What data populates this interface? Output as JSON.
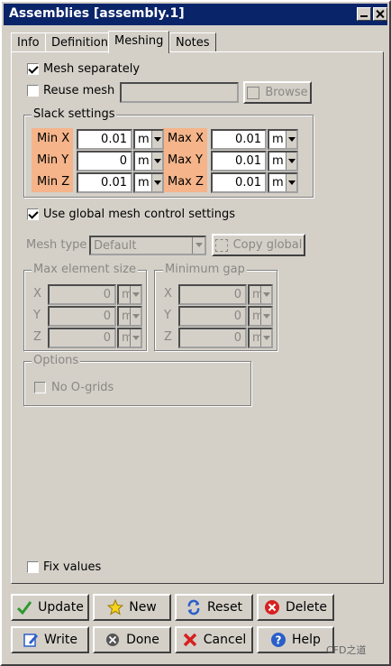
{
  "window": {
    "title": "Assemblies [assembly.1]"
  },
  "tabs": [
    {
      "label": "Info"
    },
    {
      "label": "Definition"
    },
    {
      "label": "Meshing"
    },
    {
      "label": "Notes"
    }
  ],
  "meshing": {
    "mesh_separately": {
      "label": "Mesh separately",
      "checked": true
    },
    "reuse_mesh": {
      "label": "Reuse mesh",
      "checked": false,
      "value": ""
    },
    "browse_label": "Browse",
    "slack": {
      "title": "Slack settings",
      "min_x": {
        "label": "Min X",
        "value": "0.01",
        "unit": "m"
      },
      "min_y": {
        "label": "Min Y",
        "value": "0",
        "unit": "m"
      },
      "min_z": {
        "label": "Min Z",
        "value": "0.01",
        "unit": "m"
      },
      "max_x": {
        "label": "Max X",
        "value": "0.01",
        "unit": "m"
      },
      "max_y": {
        "label": "Max Y",
        "value": "0.01",
        "unit": "m"
      },
      "max_z": {
        "label": "Max Z",
        "value": "0.01",
        "unit": "m"
      }
    },
    "use_global": {
      "label": "Use global mesh control settings",
      "checked": true
    },
    "mesh_type": {
      "label": "Mesh type",
      "value": "Default"
    },
    "copy_global_label": "Copy global",
    "max_element_size": {
      "title": "Max element size",
      "x": {
        "label": "X",
        "value": "0",
        "unit": "m"
      },
      "y": {
        "label": "Y",
        "value": "0",
        "unit": "m"
      },
      "z": {
        "label": "Z",
        "value": "0",
        "unit": "m"
      }
    },
    "minimum_gap": {
      "title": "Minimum gap",
      "x": {
        "label": "X",
        "value": "0",
        "unit": "m"
      },
      "y": {
        "label": "Y",
        "value": "0",
        "unit": "m"
      },
      "z": {
        "label": "Z",
        "value": "0",
        "unit": "m"
      }
    },
    "options": {
      "title": "Options",
      "no_ogrids": {
        "label": "No O-grids",
        "checked": false
      }
    },
    "fix_values": {
      "label": "Fix values",
      "checked": false
    }
  },
  "buttons": {
    "update": "Update",
    "new": "New",
    "reset": "Reset",
    "delete": "Delete",
    "write": "Write",
    "done": "Done",
    "cancel": "Cancel",
    "help": "Help"
  },
  "watermark": "CFD之道"
}
